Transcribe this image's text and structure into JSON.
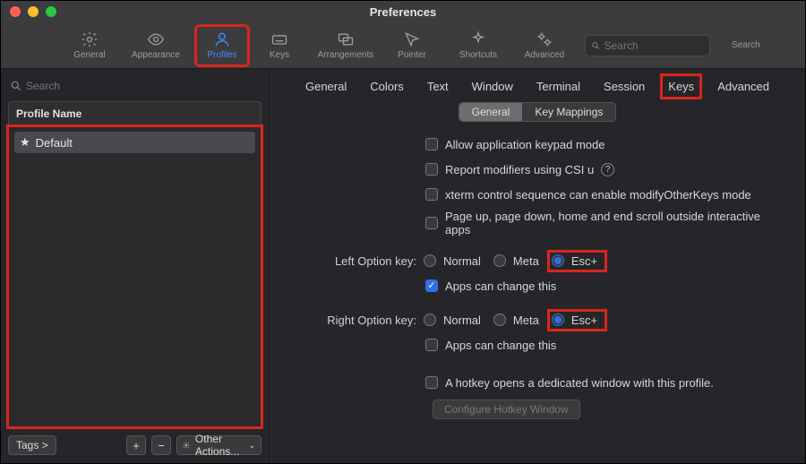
{
  "window": {
    "title": "Preferences"
  },
  "toolbar": {
    "items": [
      {
        "label": "General",
        "icon": "gear"
      },
      {
        "label": "Appearance",
        "icon": "eye"
      },
      {
        "label": "Profiles",
        "icon": "person",
        "active": true
      },
      {
        "label": "Keys",
        "icon": "keyboard"
      },
      {
        "label": "Arrangements",
        "icon": "windows"
      },
      {
        "label": "Pointer",
        "icon": "pointer"
      },
      {
        "label": "Shortcuts",
        "icon": "sparkle"
      },
      {
        "label": "Advanced",
        "icon": "gears"
      }
    ],
    "search": {
      "placeholder": "Search",
      "label": "Search"
    }
  },
  "sidebar": {
    "search_placeholder": "Search",
    "header": "Profile Name",
    "profiles": [
      {
        "name": "Default",
        "starred": true
      }
    ],
    "footer": {
      "tags": "Tags >",
      "other": "Other Actions..."
    }
  },
  "main": {
    "tabs1": [
      "General",
      "Colors",
      "Text",
      "Window",
      "Terminal",
      "Session",
      "Keys",
      "Advanced"
    ],
    "tabs1_active": "Keys",
    "tabs2": [
      {
        "label": "General",
        "active": true
      },
      {
        "label": "Key Mappings",
        "active": false
      }
    ],
    "checks": [
      {
        "label": "Allow application keypad mode",
        "checked": false
      },
      {
        "label": "Report modifiers using CSI u",
        "checked": false,
        "help": true
      },
      {
        "label": "xterm control sequence can enable modifyOtherKeys mode",
        "checked": false
      },
      {
        "label": "Page up, page down, home and end scroll outside interactive apps",
        "checked": false
      }
    ],
    "left_option": {
      "label": "Left Option key:",
      "options": [
        "Normal",
        "Meta",
        "Esc+"
      ],
      "selected": "Esc+",
      "apps_can_change": {
        "label": "Apps can change this",
        "checked": true
      }
    },
    "right_option": {
      "label": "Right Option key:",
      "options": [
        "Normal",
        "Meta",
        "Esc+"
      ],
      "selected": "Esc+",
      "apps_can_change": {
        "label": "Apps can change this",
        "checked": false
      }
    },
    "hotkey": {
      "label": "A hotkey opens a dedicated window with this profile.",
      "checked": false,
      "button": "Configure Hotkey Window"
    }
  }
}
